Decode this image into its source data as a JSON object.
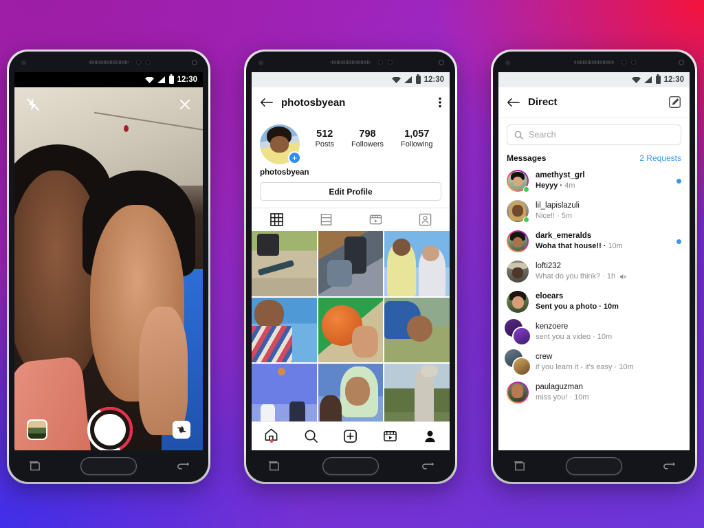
{
  "background": {
    "gradient_colors": [
      "#a31fb0",
      "#f5123c",
      "#3f2fe8",
      "#6b35d8"
    ]
  },
  "status_bar": {
    "time": "12:30",
    "icons": [
      "wifi-icon",
      "signal-icon",
      "battery-icon"
    ]
  },
  "phone_camera": {
    "name": "Instagram Camera",
    "flash_icon": "flash-off-icon",
    "close_icon": "close-icon",
    "gallery_icon": "gallery-thumbnail",
    "shutter_icon": "shutter-button",
    "flip_icon": "camera-flip-icon"
  },
  "phone_profile": {
    "back_icon": "back-arrow-icon",
    "title": "photosbyean",
    "menu_icon": "overflow-menu-icon",
    "avatar_badge": "+",
    "username": "photosbyean",
    "stats": [
      {
        "value": "512",
        "label": "Posts"
      },
      {
        "value": "798",
        "label": "Followers"
      },
      {
        "value": "1,057",
        "label": "Following"
      }
    ],
    "edit_profile_label": "Edit Profile",
    "tabs": [
      {
        "name": "grid-tab",
        "icon": "grid-icon"
      },
      {
        "name": "guides-tab",
        "icon": "guides-icon"
      },
      {
        "name": "reels-tab",
        "icon": "reels-icon"
      },
      {
        "name": "tagged-tab",
        "icon": "tagged-icon"
      }
    ],
    "grid_photos": [
      "skateboard-on-path",
      "friends-sitting-on-bench",
      "two-boys-under-sky",
      "boy-with-striped-sweater",
      "boy-holding-basketball",
      "boy-tilted-by-fence",
      "friends-playing-volleyball",
      "boy-in-green-hood",
      "person-reaching-up-statue"
    ],
    "bottom_nav": [
      {
        "name": "home-nav",
        "icon": "home-icon",
        "badge": true
      },
      {
        "name": "search-nav",
        "icon": "search-icon",
        "badge": false
      },
      {
        "name": "add-nav",
        "icon": "plus-square-icon",
        "badge": false
      },
      {
        "name": "reels-nav",
        "icon": "reels-icon",
        "badge": false
      },
      {
        "name": "profile-nav",
        "icon": "person-icon",
        "badge": false
      }
    ]
  },
  "phone_direct": {
    "back_icon": "back-arrow-icon",
    "title": "Direct",
    "compose_icon": "compose-icon",
    "search_placeholder": "Search",
    "search_icon": "search-icon",
    "section_label": "Messages",
    "requests_label": "2 Requests",
    "requests_color": "#3897f0",
    "threads": [
      {
        "username": "amethyst_grl",
        "preview": "Heyyy",
        "time": "4m",
        "unread": true,
        "online": true,
        "story_ring": true,
        "muted": false,
        "group": false
      },
      {
        "username": "lil_lapislazuli",
        "preview": "Nice!!",
        "time": "5m",
        "unread": false,
        "online": true,
        "story_ring": false,
        "muted": false,
        "group": false
      },
      {
        "username": "dark_emeralds",
        "preview": "Woha that house!!",
        "time": "10m",
        "unread": true,
        "online": false,
        "story_ring": true,
        "muted": false,
        "group": false
      },
      {
        "username": "lofti232",
        "preview": "What do you think?",
        "time": "1h",
        "unread": false,
        "online": false,
        "story_ring": false,
        "muted": true,
        "group": false
      },
      {
        "username": "eloears",
        "preview": "Sent you a photo",
        "time": "10m",
        "unread": false,
        "online": false,
        "story_ring": false,
        "muted": false,
        "group": false,
        "bold_preview": true
      },
      {
        "username": "kenzoere",
        "preview": "sent you a video",
        "time": "10m",
        "unread": false,
        "online": false,
        "story_ring": false,
        "muted": false,
        "group": true
      },
      {
        "username": "crew",
        "preview": "if you learn it - it's easy",
        "time": "10m",
        "unread": false,
        "online": false,
        "story_ring": false,
        "muted": false,
        "group": true
      },
      {
        "username": "paulaguzman",
        "preview": "miss you!",
        "time": "10m",
        "unread": false,
        "online": false,
        "story_ring": true,
        "muted": false,
        "group": false
      }
    ]
  },
  "android_keys": {
    "recents": "recents-key",
    "home": "home-key",
    "back": "back-key"
  }
}
